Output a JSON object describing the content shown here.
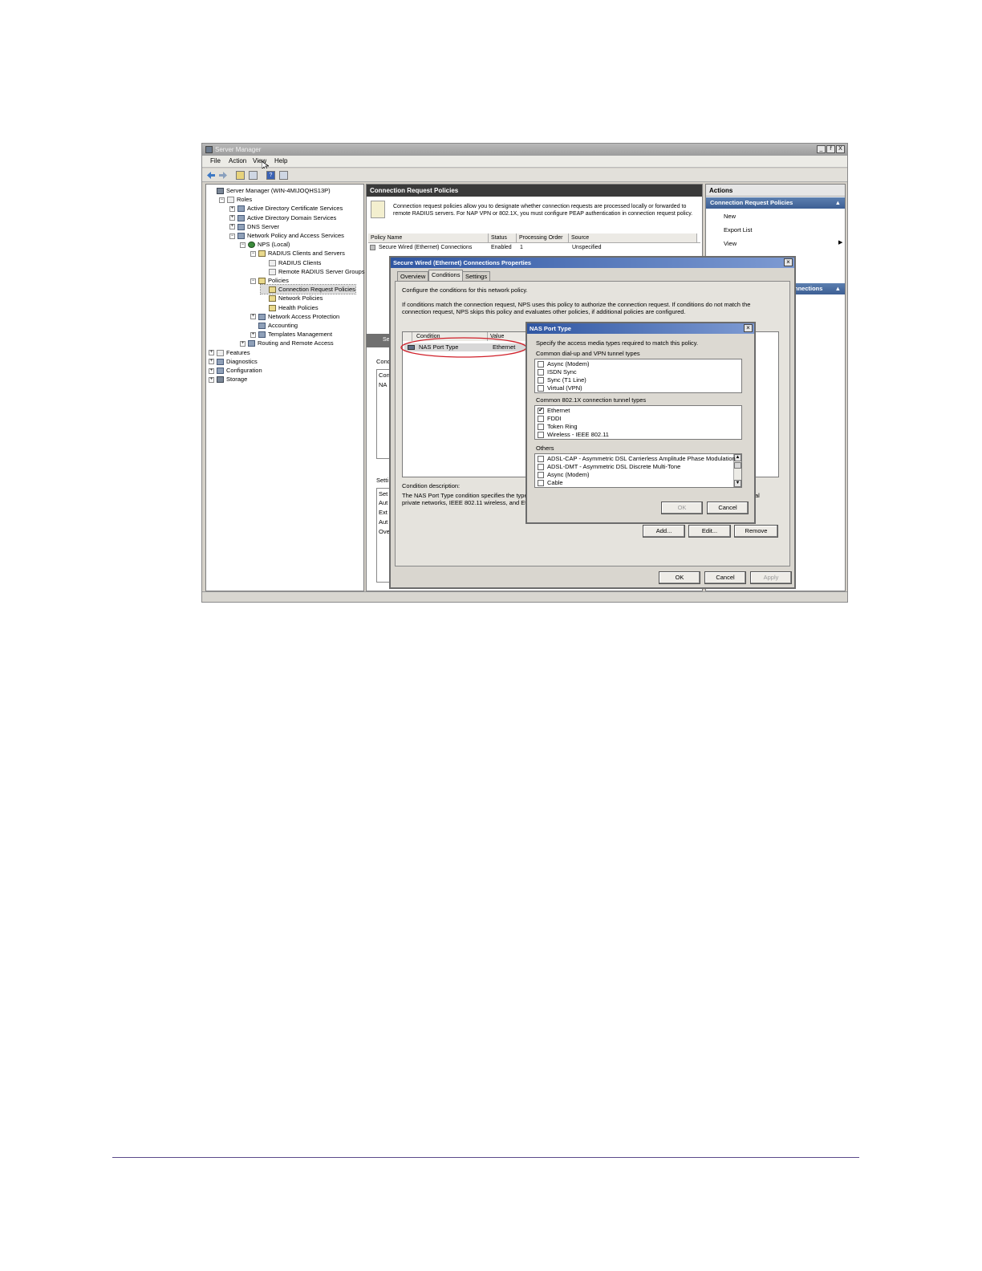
{
  "window": {
    "title": "Server Manager",
    "buttons": [
      "_",
      "ř",
      "X"
    ]
  },
  "menu": [
    "File",
    "Action",
    "View",
    "Help"
  ],
  "tree": [
    {
      "label": "Server Manager (WIN-4MIJOQHS13P)",
      "indent": 0,
      "exp": "",
      "icon": "server"
    },
    {
      "label": "Roles",
      "indent": 1,
      "exp": "−",
      "icon": "doc"
    },
    {
      "label": "Active Directory Certificate Services",
      "indent": 2,
      "exp": "+",
      "icon": "gear"
    },
    {
      "label": "Active Directory Domain Services",
      "indent": 2,
      "exp": "+",
      "icon": "gear"
    },
    {
      "label": "DNS Server",
      "indent": 2,
      "exp": "+",
      "icon": "gear"
    },
    {
      "label": "Network Policy and Access Services",
      "indent": 2,
      "exp": "−",
      "icon": "gear"
    },
    {
      "label": "NPS (Local)",
      "indent": 3,
      "exp": "−",
      "icon": "globe"
    },
    {
      "label": "RADIUS Clients and Servers",
      "indent": 4,
      "exp": "−",
      "icon": "folder"
    },
    {
      "label": "RADIUS Clients",
      "indent": 5,
      "exp": "",
      "icon": "doc"
    },
    {
      "label": "Remote RADIUS Server Groups",
      "indent": 5,
      "exp": "",
      "icon": "doc"
    },
    {
      "label": "Policies",
      "indent": 4,
      "exp": "−",
      "icon": "folder"
    },
    {
      "label": "Connection Request Policies",
      "indent": 5,
      "exp": "",
      "icon": "folder"
    },
    {
      "label": "Network Policies",
      "indent": 5,
      "exp": "",
      "icon": "folder"
    },
    {
      "label": "Health Policies",
      "indent": 5,
      "exp": "",
      "icon": "folder"
    },
    {
      "label": "Network Access Protection",
      "indent": 4,
      "exp": "+",
      "icon": "gear"
    },
    {
      "label": "Accounting",
      "indent": 4,
      "exp": "",
      "icon": "gear"
    },
    {
      "label": "Templates Management",
      "indent": 4,
      "exp": "+",
      "icon": "gear"
    },
    {
      "label": "Routing and Remote Access",
      "indent": 3,
      "exp": "+",
      "icon": "gear"
    },
    {
      "label": "Features",
      "indent": 0,
      "exp": "+",
      "icon": "doc"
    },
    {
      "label": "Diagnostics",
      "indent": 0,
      "exp": "+",
      "icon": "gear"
    },
    {
      "label": "Configuration",
      "indent": 0,
      "exp": "+",
      "icon": "gear"
    },
    {
      "label": "Storage",
      "indent": 0,
      "exp": "+",
      "icon": "server"
    }
  ],
  "center": {
    "title": "Connection Request Policies",
    "description": "Connection request policies allow you to designate whether connection requests are processed locally or forwarded to remote RADIUS servers. For NAP VPN or 802.1X, you must configure PEAP authentication in connection request policy.",
    "columns": [
      "Policy Name",
      "Status",
      "Processing Order",
      "Source"
    ],
    "row": [
      "Secure Wired (Ethernet) Connections",
      "Enabled",
      "1",
      "Unspecified"
    ],
    "lower_fragments": [
      "Se",
      "Cond",
      "Con",
      "NA",
      "Setti",
      "Set",
      "Aut",
      "Ext",
      "Aut",
      "Ove"
    ]
  },
  "actions": {
    "title": "Actions",
    "section1": "Connection Request Policies",
    "items": [
      "New",
      "Export List",
      "View"
    ],
    "section2": "nnections"
  },
  "props": {
    "title": "Secure Wired (Ethernet) Connections Properties",
    "tabs": [
      "Overview",
      "Conditions",
      "Settings"
    ],
    "intro": "Configure the conditions for this network policy.",
    "explain": "If conditions match the connection request, NPS uses this policy to authorize the connection request. If conditions do not match the connection request, NPS skips this policy and evaluates other policies, if additional policies are configured.",
    "columns": [
      "Condition",
      "Value"
    ],
    "condition": "NAS Port Type",
    "value": "Ethernet",
    "desc_label": "Condition description:",
    "desc_text1": "The NAS Port Type condition specifies the type",
    "desc_text2": "private networks, IEEE 802.11 wireless, and Et",
    "desc_tail": "al",
    "buttons": [
      "Add...",
      "Edit...",
      "Remove"
    ],
    "footer": [
      "OK",
      "Cancel",
      "Apply"
    ]
  },
  "nas": {
    "title": "NAS Port Type",
    "intro": "Specify the access media types required to match this policy.",
    "groups": [
      {
        "label": "Common dial-up and VPN tunnel types",
        "items": [
          {
            "text": "Async (Modem)",
            "checked": false
          },
          {
            "text": "ISDN Sync",
            "checked": false
          },
          {
            "text": "Sync (T1 Line)",
            "checked": false
          },
          {
            "text": "Virtual (VPN)",
            "checked": false
          }
        ]
      },
      {
        "label": "Common 802.1X connection tunnel types",
        "items": [
          {
            "text": "Ethernet",
            "checked": true
          },
          {
            "text": "FDDI",
            "checked": false
          },
          {
            "text": "Token Ring",
            "checked": false
          },
          {
            "text": "Wireless - IEEE 802.11",
            "checked": false
          }
        ]
      },
      {
        "label": "Others",
        "items": [
          {
            "text": "ADSL-CAP - Asymmetric DSL Carrierless Amplitude Phase Modulation",
            "checked": false
          },
          {
            "text": "ADSL-DMT - Asymmetric DSL Discrete Multi-Tone",
            "checked": false
          },
          {
            "text": "Async (Modem)",
            "checked": false
          },
          {
            "text": "Cable",
            "checked": false
          }
        ]
      }
    ],
    "ok": "OK",
    "cancel": "Cancel"
  },
  "colors": {
    "accent": "#2f56a2",
    "highlight": "#d0202a",
    "footer_rule": "#5b4a8a"
  }
}
